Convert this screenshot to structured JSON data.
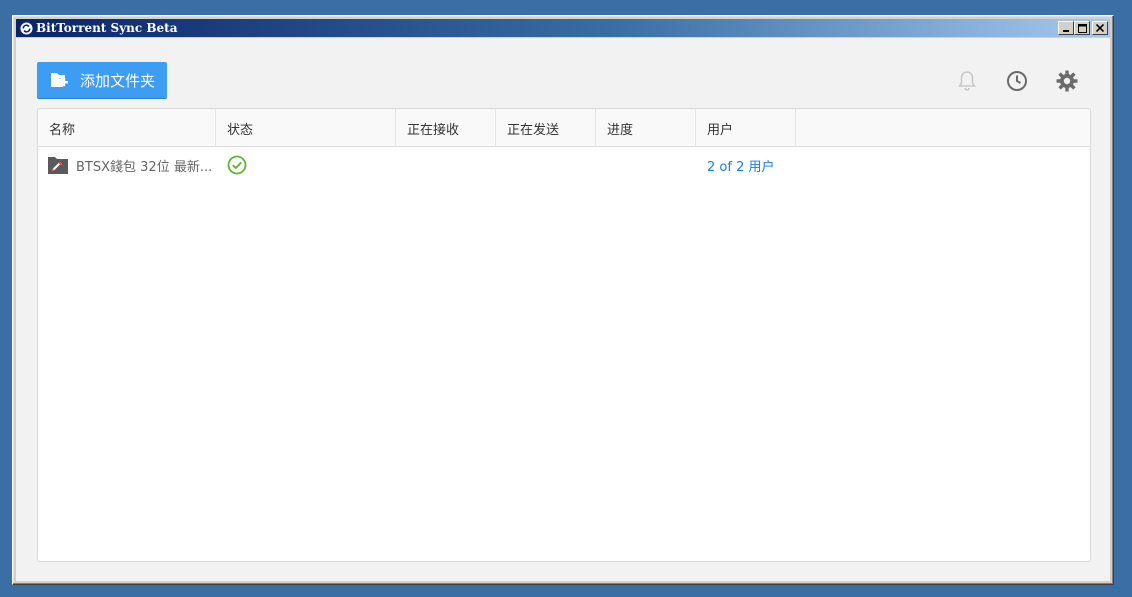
{
  "window": {
    "title": "BitTorrent Sync Beta"
  },
  "toolbar": {
    "add_folder_label": "添加文件夹",
    "icons": [
      "bell-icon",
      "history-clock-icon",
      "settings-gear-icon"
    ]
  },
  "table": {
    "columns": [
      "名称",
      "状态",
      "正在接收",
      "正在发送",
      "进度",
      "用户"
    ],
    "rows": [
      {
        "name": "BTSX錢包 32位 最新...",
        "status": "check-icon",
        "receiving": "",
        "sending": "",
        "progress": "",
        "users": "2 of 2 用户"
      }
    ]
  },
  "colors": {
    "accent": "#3d9df2",
    "link": "#1a7ed8",
    "status_ok": "#5fb336"
  }
}
